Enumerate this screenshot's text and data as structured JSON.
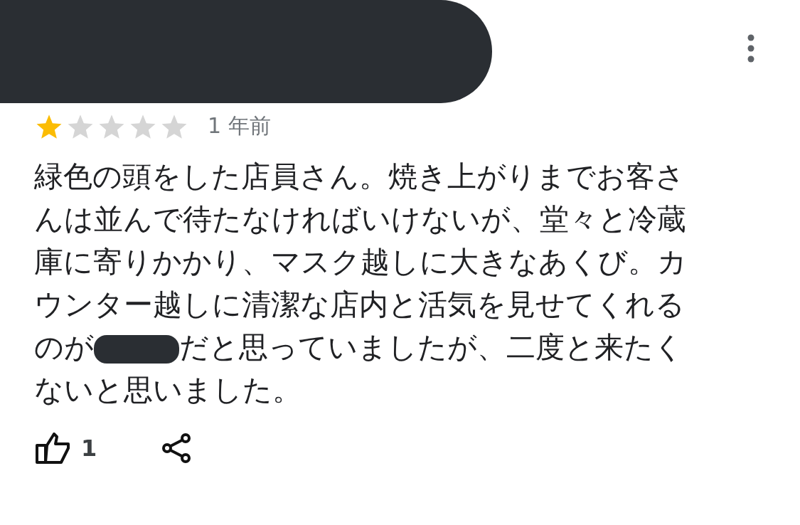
{
  "header": {
    "redacted": true
  },
  "rating": {
    "stars": 1
  },
  "time": "1 年前",
  "review": [
    {
      "kind": "text",
      "text": "緑色の頭をした店員さん。焼き上がりまでお客さんは並んで待たなければいけないが、堂々と冷蔵庫に寄りかかり、マスク越しに大きなあくび。カウンター越しに清潔な店内と活気を見せてくれるのが"
    },
    {
      "kind": "redaction"
    },
    {
      "kind": "text",
      "text": "だと思っていましたが、二度と来たくないと思いました。"
    }
  ],
  "likes": "1"
}
